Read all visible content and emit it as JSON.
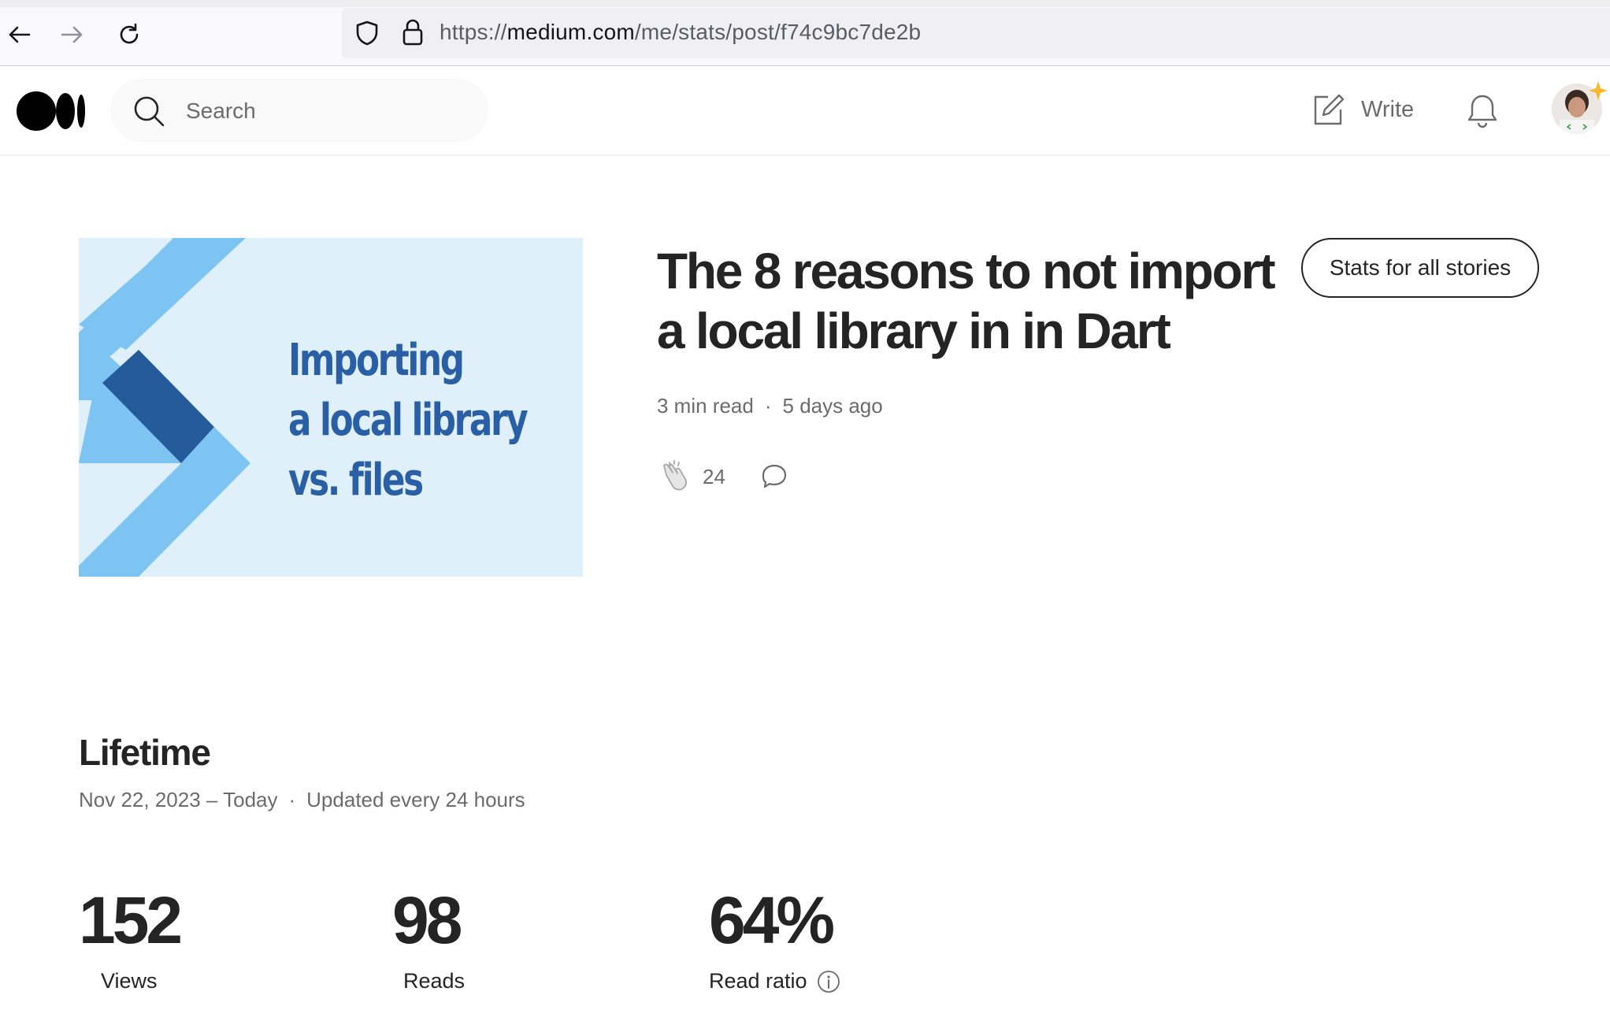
{
  "browser": {
    "url_scheme": "https://",
    "url_host": "medium.com",
    "url_path": "/me/stats/post/f74c9bc7de2b"
  },
  "header": {
    "search_placeholder": "Search",
    "write_label": "Write"
  },
  "article": {
    "image_text_line1": "Importing",
    "image_text_line2": "a local library",
    "image_text_line3": "vs. files",
    "title": "The 8 reasons to not import a local library in in Dart",
    "stats_all_label": "Stats for all stories",
    "read_time": "3 min read",
    "separator": "·",
    "published": "5 days ago",
    "claps": "24"
  },
  "lifetime": {
    "title": "Lifetime",
    "range": "Nov 22, 2023 – Today",
    "separator": "·",
    "update_note": "Updated every 24 hours",
    "stats": [
      {
        "value": "152",
        "label": "Views"
      },
      {
        "value": "98",
        "label": "Reads"
      },
      {
        "value": "64%",
        "label": "Read ratio"
      }
    ]
  },
  "colors": {
    "image_bg": "#dff0fb",
    "image_light_blue": "#7dc4f2",
    "image_dark_blue": "#255a9b",
    "image_text": "#2a5fa6",
    "text_primary": "#242424",
    "text_secondary": "#6b6b6b"
  },
  "icons": [
    "back-arrow-icon",
    "forward-arrow-icon",
    "reload-icon",
    "shield-icon",
    "lock-icon",
    "medium-logo",
    "search-icon",
    "write-icon",
    "bell-icon",
    "clap-icon",
    "comment-icon",
    "info-icon"
  ]
}
